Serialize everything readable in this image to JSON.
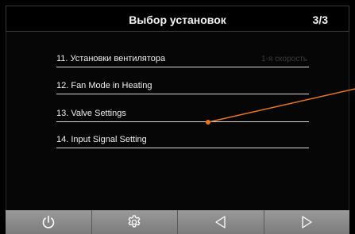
{
  "header": {
    "title": "Выбор установок",
    "page": "3/3"
  },
  "menu": {
    "items": [
      {
        "label": "11. Установки вентилятора",
        "value": "1-я скорость"
      },
      {
        "label": "12. Fan Mode in Heating",
        "value": ""
      },
      {
        "label": "13. Valve Settings",
        "value": ""
      },
      {
        "label": "14. Input Signal Setting",
        "value": ""
      }
    ]
  },
  "toolbar": {
    "buttons": [
      {
        "icon": "power-icon"
      },
      {
        "icon": "gear-icon"
      },
      {
        "icon": "triangle-left-icon"
      },
      {
        "icon": "triangle-right-icon"
      }
    ]
  },
  "colors": {
    "pointer": "#e8761e",
    "text": "#f0f0f0",
    "toolbar": "#8a8a8a"
  }
}
